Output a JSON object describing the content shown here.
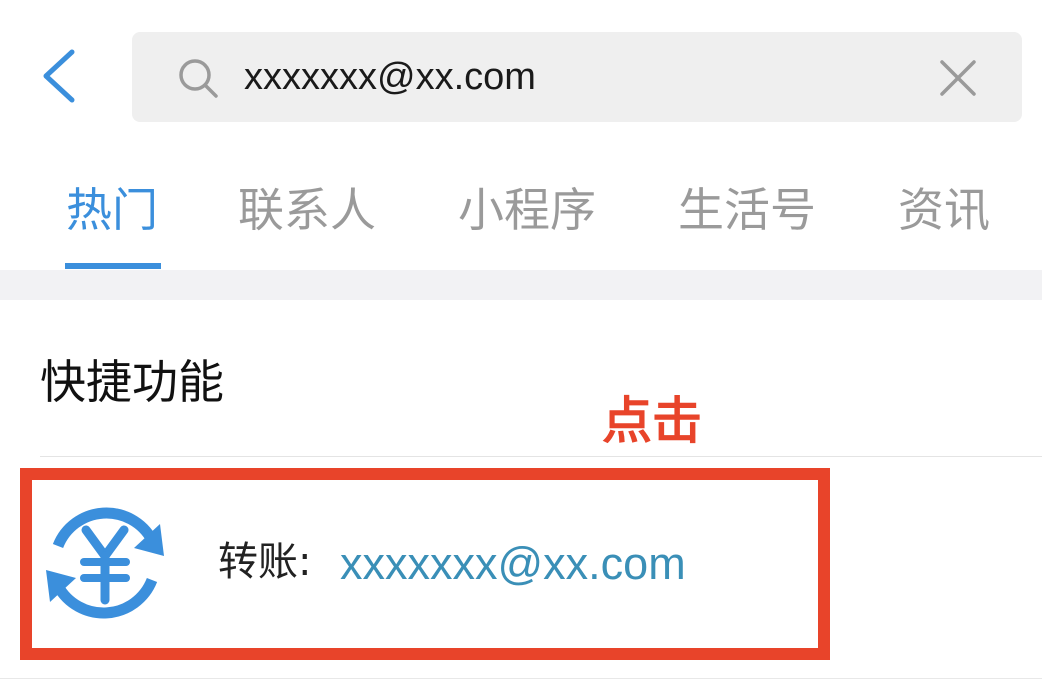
{
  "header": {
    "back_icon": "chevron-left-icon",
    "search": {
      "icon": "search-icon",
      "value": "xxxxxxx@xx.com",
      "clear_icon": "close-icon"
    }
  },
  "tabs": [
    {
      "label": "热门",
      "active": true
    },
    {
      "label": "联系人",
      "active": false
    },
    {
      "label": "小程序",
      "active": false
    },
    {
      "label": "生活号",
      "active": false
    },
    {
      "label": "资讯",
      "active": false
    }
  ],
  "section": {
    "title": "快捷功能",
    "annotation": "点击",
    "result": {
      "icon": "yuan-transfer-icon",
      "label": "转账:",
      "value": "xxxxxxx@xx.com"
    }
  },
  "colors": {
    "accent": "#3b8fdc",
    "highlight": "#e8442a",
    "link": "#3a8fb7"
  }
}
